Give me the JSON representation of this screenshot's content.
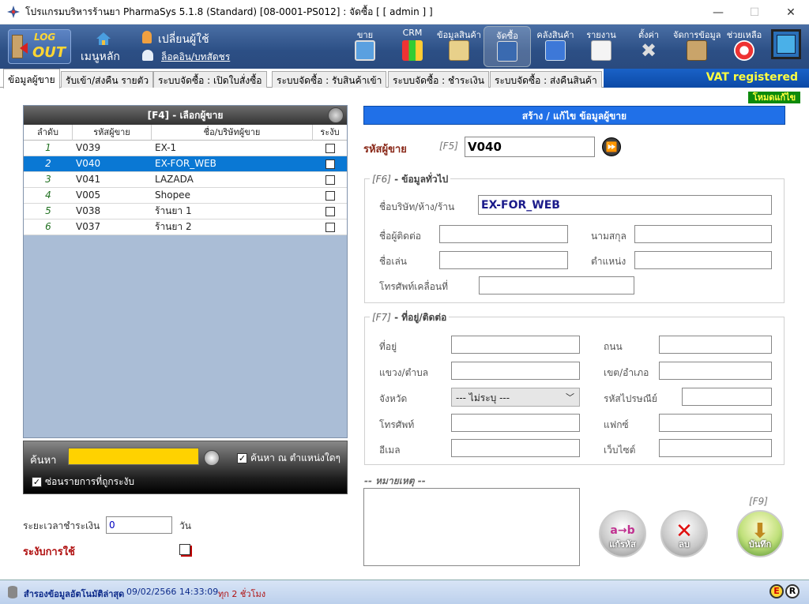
{
  "window": {
    "title": "โปรแกรมบริหารร้านยา PharmaSys 5.1.8 (Standard) [08-0001-PS012] : จัดซื้อ  [ [ admin ] ]",
    "minimize": "—",
    "maximize": "☐",
    "close": "✕"
  },
  "toolbar": {
    "logout_line1": "LOG",
    "logout_line2": "OUT",
    "home_label": "เมนูหลัก",
    "change_user_label": "เปลี่ยนผู้ใช้",
    "login_log_label": "ล็อคอิน/บทสัดชร",
    "items": [
      {
        "label": "ขาย"
      },
      {
        "label": "CRM"
      },
      {
        "label": "ข้อมูลสินค้า"
      },
      {
        "label": "จัดซื้อ"
      },
      {
        "label": "คลังสินค้า"
      },
      {
        "label": "รายงาน"
      },
      {
        "label": "ตั้งค่า"
      },
      {
        "label": "จัดการข้อมูล"
      },
      {
        "label": "ช่วยเหลือ"
      }
    ]
  },
  "tabs": [
    {
      "label": "ข้อมูลผู้ขาย",
      "active": true
    },
    {
      "label": "รับเข้า/ส่งคืน รายตัว"
    },
    {
      "label": "ระบบจัดซื้อ : เปิดใบสั่งซื้อ"
    },
    {
      "label": "ระบบจัดซื้อ : รับสินค้าเข้า"
    },
    {
      "label": "ระบบจัดซื้อ : ชำระเงิน"
    },
    {
      "label": "ระบบจัดซื้อ : ส่งคืนสินค้า"
    }
  ],
  "vat_banner": "VAT registered",
  "edit_mode": "โหมดแก้ไข",
  "vendor_list": {
    "title": "[F4] - เลือกผู้ขาย",
    "columns": [
      "ลำดับ",
      "รหัสผู้ขาย",
      "ชื่อ/บริษัทผู้ขาย",
      "ระงับ"
    ],
    "rows": [
      {
        "no": "1",
        "code": "V039",
        "name": "EX-1",
        "suspended": false
      },
      {
        "no": "2",
        "code": "V040",
        "name": "EX-FOR_WEB",
        "suspended": false,
        "selected": true
      },
      {
        "no": "3",
        "code": "V041",
        "name": "LAZADA",
        "suspended": false
      },
      {
        "no": "4",
        "code": "V005",
        "name": "Shopee",
        "suspended": false
      },
      {
        "no": "5",
        "code": "V038",
        "name": "ร้านยา 1",
        "suspended": false
      },
      {
        "no": "6",
        "code": "V037",
        "name": "ร้านยา 2",
        "suspended": false
      }
    ]
  },
  "search": {
    "label": "ค้นหา",
    "value": "",
    "any_position_label": "ค้นหา ณ ตำแหน่งใดๆ",
    "any_position_checked": true,
    "hide_suspended_label": "ซ่อนรายการที่ถูกระงับ",
    "hide_suspended_checked": true,
    "check_mark": "✓"
  },
  "payment": {
    "label": "ระยะเวลาชำระเงิน",
    "value": "0",
    "unit": "วัน"
  },
  "suspend": {
    "label": "ระงับการใช้"
  },
  "form": {
    "header": "สร้าง / แก้ไข ข้อมูลผู้ขาย",
    "vendor_code_label": "รหัสผู้ขาย",
    "vendor_code_key": "[F5]",
    "vendor_code_value": "V040",
    "general": {
      "key": "[F6]",
      "title": " - ข้อมูลทั่วไป",
      "company_label": "ชื่อบริษัท/ห้าง/ร้าน",
      "company_value": "EX-FOR_WEB",
      "contact_label": "ชื่อผู้ติดต่อ",
      "contact_value": "",
      "surname_label": "นามสกุล",
      "surname_value": "",
      "nickname_label": "ชื่อเล่น",
      "nickname_value": "",
      "position_label": "ตำแหน่ง",
      "position_value": "",
      "mobile_label": "โทรศัพท์เคลื่อนที่",
      "mobile_value": ""
    },
    "address": {
      "key": "[F7]",
      "title": " - ที่อยู่/ติดต่อ",
      "address_label": "ที่อยู่",
      "road_label": "ถนน",
      "subdistrict_label": "แขวง/ตำบล",
      "district_label": "เขต/อำเภอ",
      "province_label": "จังหวัด",
      "province_value": "--- ไม่ระบุ ---",
      "postcode_label": "รหัสไปรษณีย์",
      "phone_label": "โทรศัพท์",
      "fax_label": "แฟกซ์",
      "email_label": "อีเมล",
      "website_label": "เว็บไซต์"
    },
    "note_label": "-- หมายเหตุ --",
    "note_value": "",
    "f9_key": "[F9]",
    "edit_code_label": "แก้รหัส",
    "delete_label": "ลบ",
    "save_label": "บันทึก"
  },
  "status": {
    "backup_label": "สำรองข้อมูลอัตโนมัติล่าสุด",
    "backup_time": "09/02/2566 14:33:09",
    "interval": "ทุก 2 ชั่วโมง",
    "badge_e": "E",
    "badge_r": "R"
  }
}
